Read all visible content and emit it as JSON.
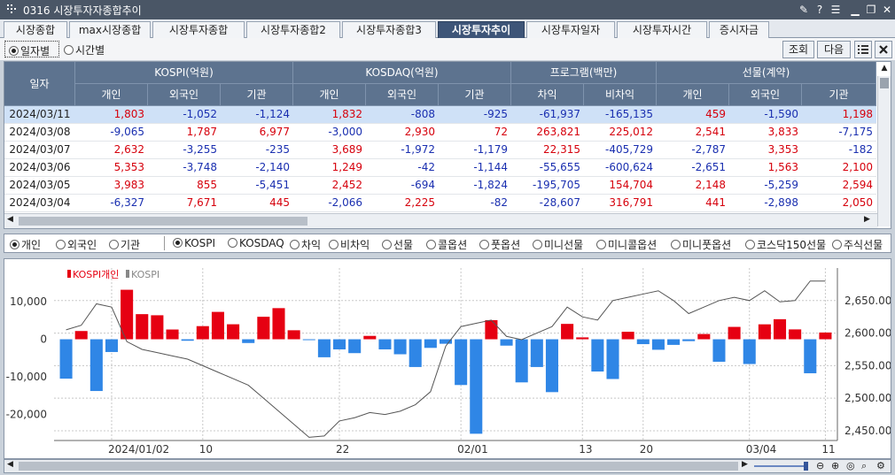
{
  "window": {
    "title": "0316 시장투자자종합추이",
    "controls": [
      "pin",
      "help",
      "menu",
      "minimize",
      "restore",
      "close"
    ]
  },
  "tabs": [
    {
      "label": "시장종합",
      "active": false
    },
    {
      "label": "max시장종합",
      "active": false
    },
    {
      "label": "시장투자종합",
      "active": false
    },
    {
      "label": "시장투자종합2",
      "active": false
    },
    {
      "label": "시장투자종합3",
      "active": false
    },
    {
      "label": "시장투자추이",
      "active": true
    },
    {
      "label": "시장투자일자",
      "active": false
    },
    {
      "label": "시장투자시간",
      "active": false
    },
    {
      "label": "증시자금",
      "active": false
    }
  ],
  "toolbar": {
    "daily_label": "일자별",
    "time_label": "시간별",
    "query_label": "조회",
    "next_label": "다음"
  },
  "table": {
    "date_header": "일자",
    "groups": [
      "KOSPI(억원)",
      "KOSDAQ(억원)",
      "프로그램(백만)",
      "선물(계약)"
    ],
    "subheaders": [
      "개인",
      "외국인",
      "기관",
      "개인",
      "외국인",
      "기관",
      "차익",
      "비차익",
      "개인",
      "외국인",
      "기관"
    ],
    "rows": [
      {
        "date": "2024/03/11",
        "cells": [
          "1,803",
          "-1,052",
          "-1,124",
          "1,832",
          "-808",
          "-925",
          "-61,937",
          "-165,135",
          "459",
          "-1,590",
          "1,198"
        ]
      },
      {
        "date": "2024/03/08",
        "cells": [
          "-9,065",
          "1,787",
          "6,977",
          "-3,000",
          "2,930",
          "72",
          "263,821",
          "225,012",
          "2,541",
          "3,833",
          "-7,175"
        ]
      },
      {
        "date": "2024/03/07",
        "cells": [
          "2,632",
          "-3,255",
          "-235",
          "3,689",
          "-1,972",
          "-1,179",
          "22,315",
          "-405,729",
          "-2,787",
          "3,353",
          "-182"
        ]
      },
      {
        "date": "2024/03/06",
        "cells": [
          "5,353",
          "-3,748",
          "-2,140",
          "1,249",
          "-42",
          "-1,144",
          "-55,655",
          "-600,624",
          "-2,651",
          "1,563",
          "2,100"
        ]
      },
      {
        "date": "2024/03/05",
        "cells": [
          "3,983",
          "855",
          "-5,451",
          "2,452",
          "-694",
          "-1,824",
          "-195,705",
          "154,704",
          "2,148",
          "-5,259",
          "2,594"
        ]
      },
      {
        "date": "2024/03/04",
        "cells": [
          "-6,327",
          "7,671",
          "445",
          "-2,066",
          "2,225",
          "-82",
          "-28,607",
          "316,791",
          "441",
          "-2,898",
          "2,050"
        ]
      }
    ]
  },
  "investor_options": [
    {
      "label": "개인",
      "selected": true
    },
    {
      "label": "외국인",
      "selected": false
    },
    {
      "label": "기관",
      "selected": false
    }
  ],
  "series_options": [
    {
      "label": "KOSPI",
      "selected": true
    },
    {
      "label": "KOSDAQ",
      "selected": false
    },
    {
      "label": "차익",
      "selected": false
    },
    {
      "label": "비차익",
      "selected": false
    },
    {
      "label": "선물",
      "selected": false
    },
    {
      "label": "콜옵션",
      "selected": false
    },
    {
      "label": "풋옵션",
      "selected": false
    },
    {
      "label": "미니선물",
      "selected": false
    },
    {
      "label": "미니콜옵션",
      "selected": false
    },
    {
      "label": "미니풋옵션",
      "selected": false
    },
    {
      "label": "코스닥150선물",
      "selected": false
    },
    {
      "label": "주식선물",
      "selected": false
    }
  ],
  "colors": {
    "positive": "#e60012",
    "negative": "#2f86e6",
    "index_line": "#555555",
    "header": "#5d738f",
    "tab_active": "#3e5578"
  },
  "chart_data": {
    "type": "bar",
    "legend": [
      {
        "name": "KOSPI개인",
        "color": "#e60012"
      },
      {
        "name": "KOSPI",
        "color": "#888888"
      }
    ],
    "x_tick_labels": [
      "2024/01/02",
      "10",
      "22",
      "02/01",
      "13",
      "20",
      "03/04",
      "11"
    ],
    "x_tick_index": [
      3,
      9,
      18,
      26,
      34,
      38,
      45,
      50
    ],
    "left_axis": {
      "ticks": [
        10000,
        0,
        -10000,
        -20000
      ],
      "tick_labels": [
        "10,000",
        "0",
        "-10,000",
        "-20,000"
      ],
      "range": [
        -27000,
        19000
      ]
    },
    "right_axis": {
      "ticks": [
        2650,
        2600,
        2550,
        2500,
        2450
      ],
      "tick_labels": [
        "2,650.00",
        "2,600.00",
        "2,550.00",
        "2,500.00",
        "2,450.00"
      ],
      "range": [
        2435,
        2700
      ]
    },
    "grid": true,
    "series": [
      {
        "name": "KOSPI개인",
        "type": "bar",
        "values": [
          -10500,
          2200,
          -13800,
          -3400,
          13200,
          6700,
          6400,
          2600,
          -400,
          3500,
          7300,
          4000,
          -1000,
          6000,
          8300,
          2400,
          -200,
          -4800,
          -2700,
          -3700,
          900,
          -2700,
          -4000,
          -7400,
          -2300,
          -1200,
          -12200,
          -25200,
          5100,
          -1700,
          -11500,
          -7400,
          -14100,
          4100,
          500,
          -8600,
          -10600,
          2000,
          -1300,
          -2800,
          -1500,
          -500,
          1400,
          -6000,
          3300,
          -6600,
          3983,
          5353,
          2632,
          -9065,
          1803
        ],
        "note": "daily KOSPI individual net buy (억원)"
      },
      {
        "name": "KOSPI",
        "type": "line",
        "values": [
          2605,
          2612,
          2645,
          2640,
          2587,
          2575,
          2570,
          2565,
          2560,
          2550,
          2540,
          2530,
          2520,
          2500,
          2480,
          2460,
          2440,
          2442,
          2465,
          2470,
          2478,
          2475,
          2480,
          2490,
          2510,
          2580,
          2610,
          2615,
          2620,
          2595,
          2590,
          2600,
          2610,
          2640,
          2625,
          2620,
          2650,
          2655,
          2660,
          2665,
          2650,
          2630,
          2640,
          2650,
          2655,
          2650,
          2665,
          2648,
          2650,
          2680,
          2680
        ]
      }
    ]
  },
  "bottom_tools": [
    "zoom-out",
    "zoom-in",
    "zoom-fit",
    "zoom-reset",
    "settings"
  ]
}
